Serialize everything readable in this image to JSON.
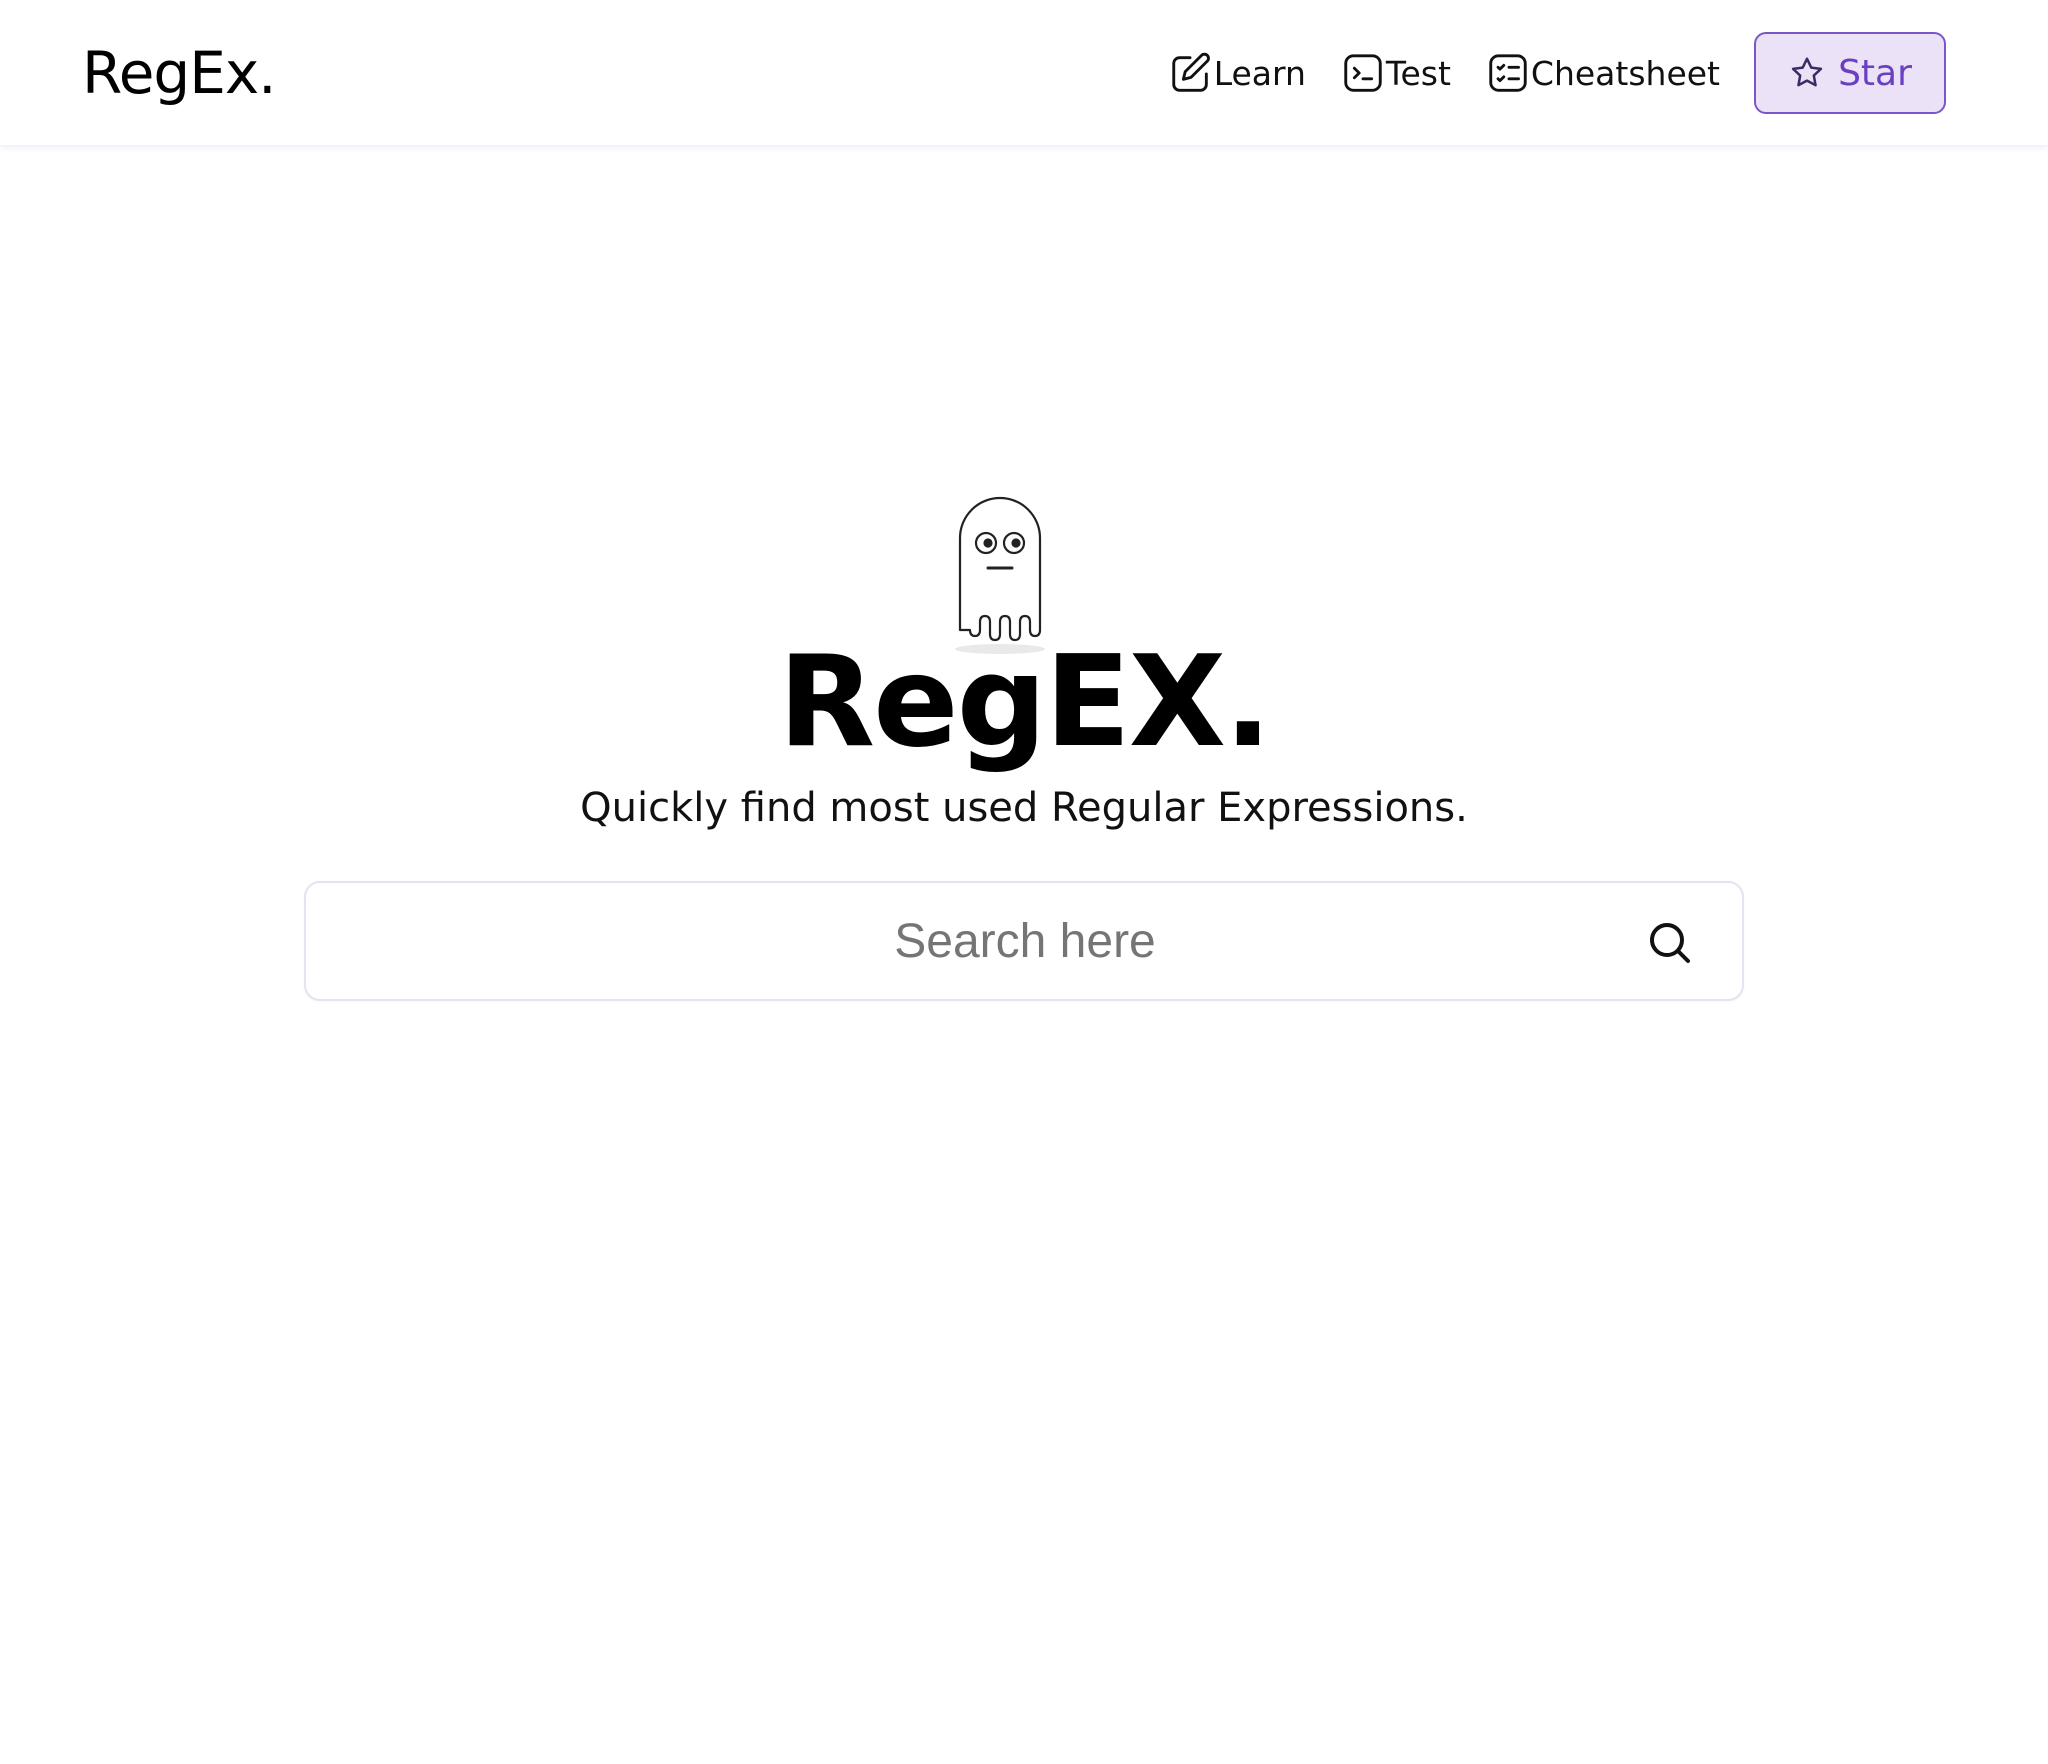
{
  "header": {
    "logo": "RegEx.",
    "nav": [
      {
        "label": "Learn",
        "icon": "edit-icon"
      },
      {
        "label": "Test",
        "icon": "terminal-icon"
      },
      {
        "label": "Cheatsheet",
        "icon": "checklist-icon"
      }
    ],
    "star_button": {
      "label": "Star",
      "icon": "star-icon"
    }
  },
  "hero": {
    "illustration": "ghost-icon",
    "title": "RegEX.",
    "tagline": "Quickly find most used Regular Expressions."
  },
  "search": {
    "placeholder": "Search here",
    "value": "",
    "icon": "search-icon"
  },
  "colors": {
    "accent": "#7a56c9",
    "accent_bg": "#ebe2f7",
    "accent_text": "#6a3fc1"
  }
}
